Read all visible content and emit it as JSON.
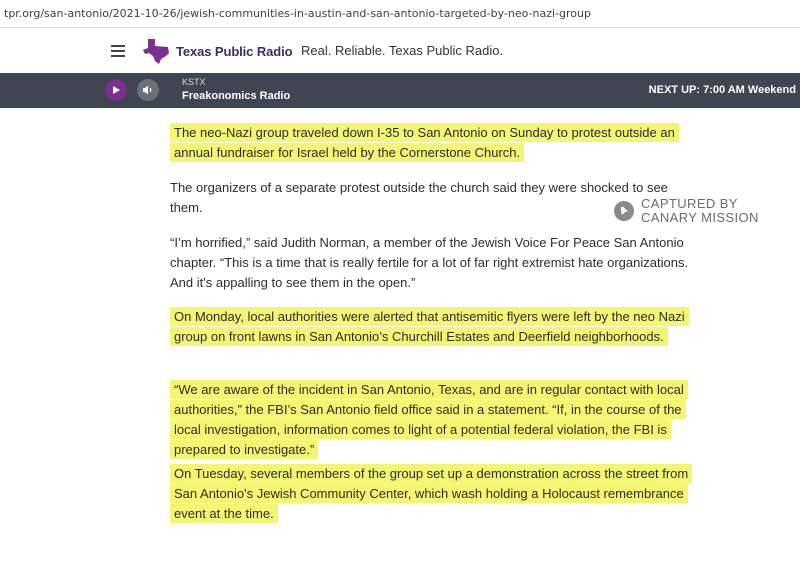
{
  "browser": {
    "url": "tpr.org/san-antonio/2021-10-26/jewish-communities-in-austin-and-san-antonio-targeted-by-neo-nazi-group"
  },
  "header": {
    "logo_text": "Texas Public Radio",
    "tagline": "Real. Reliable. Texas Public Radio."
  },
  "player": {
    "station": "KSTX",
    "program": "Freakonomics Radio",
    "next_up": "NEXT UP: 7:00 AM Weekend"
  },
  "article": {
    "paragraphs": [
      "The neo-Nazi group traveled down I-35 to San Antonio on Sunday to protest outside an annual fundraiser for Israel held by the Cornerstone Church.",
      "The organizers of a separate protest outside the church said they were shocked to see them.",
      "“I’m horrified,” said Judith Norman, a member of the Jewish Voice For Peace San Antonio chapter. “This is a time that is really fertile for a lot of far right extremist hate organizations. And it's appalling to see them in the open.”",
      "On Monday, local authorities were alerted that antisemitic flyers were left by the neo Nazi group on front lawns in San Antonio’s Churchill Estates and Deerfield neighborhoods.",
      "“We are aware of the incident in San Antonio, Texas, and are in regular contact with local authorities,” the FBI’s San Antonio field office said in a statement. “If, in the course of the local investigation, information comes to light of a potential federal violation, the FBI is prepared to investigate.”",
      "On Tuesday, several members of the group set up a demonstration across the street from San Antonio's Jewish Community Center, which wash holding a Holocaust remembrance event at the time."
    ],
    "highlighted": [
      true,
      false,
      false,
      true,
      true,
      true
    ]
  },
  "watermark": {
    "line1": "CAPTURED BY",
    "line2": "CANARY MISSION"
  },
  "colors": {
    "highlight": "#f3f573",
    "player_bg": "#3f4651",
    "play_button": "#7b2f8e",
    "brand_purple": "#7b2f8e"
  },
  "icons": {
    "menu": "hamburger-icon",
    "play": "play-icon",
    "volume": "volume-icon",
    "logo": "texas-map-icon"
  }
}
